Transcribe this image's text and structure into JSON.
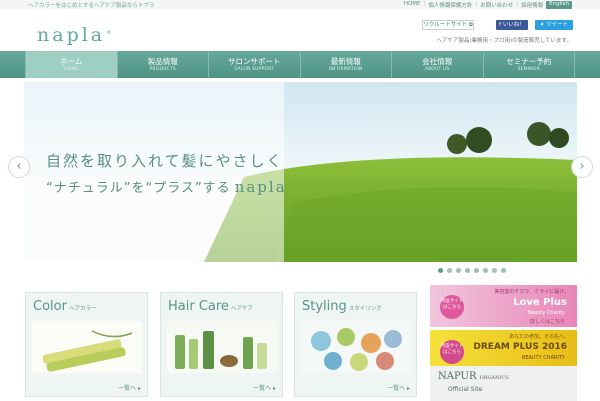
{
  "header": {
    "tagline": "ヘアカラーをはじめとするヘアケア製品ならナプラ",
    "top_links": [
      "HOME",
      "個人情報保護方針",
      "お問い合わせ",
      "採用情報"
    ],
    "english_label": "English",
    "logo": "napla",
    "logo_mark": "®",
    "recruit_label": "リクルートサイト",
    "facebook_label": "いいね！",
    "twitter_label": "ツイート",
    "subnote": "ヘアケア製品(業務用・プロ用)の製造販売しています。"
  },
  "nav": [
    {
      "jp": "ホーム",
      "en": "HOME",
      "active": true
    },
    {
      "jp": "製品情報",
      "en": "PRODUCTS",
      "active": false
    },
    {
      "jp": "サロンサポート",
      "en": "SALON SUPPORT",
      "active": false
    },
    {
      "jp": "最新情報",
      "en": "INFORMATION",
      "active": false
    },
    {
      "jp": "会社情報",
      "en": "ABOUT US",
      "active": false
    },
    {
      "jp": "セミナー予約",
      "en": "SEMINOR",
      "active": false
    }
  ],
  "hero": {
    "line1": "自然を取り入れて髪にやさしく",
    "line2": "“ナチュラル”を“プラス”する",
    "logo": "napla",
    "slide_count": 8,
    "active_slide": 0
  },
  "cards": [
    {
      "title": "Color",
      "subtitle": "ヘアカラー",
      "more": "一覧へ ▸"
    },
    {
      "title": "Hair Care",
      "subtitle": "ヘアケア",
      "more": "一覧へ ▸"
    },
    {
      "title": "Styling",
      "subtitle": "スタイリング",
      "more": "一覧へ ▸"
    }
  ],
  "banners": {
    "b1": {
      "head": "美容室のチカラ、ミライに届け。",
      "title": "Love Plus",
      "sub": "Beauty Charity",
      "badge": "特設サイトはこちら",
      "more": "詳しくはこちら"
    },
    "b2": {
      "head": "あなたの参加、その先へ。",
      "title": "DREAM PLUS 2016",
      "sub": "BEAUTY CHARITY",
      "badge": "特設サイトはこちら"
    },
    "b3": {
      "title": "NAPUR",
      "title_suffix": "ORGANICS",
      "sub": "Official Site"
    }
  },
  "colors": {
    "brand": "#5ea89c",
    "nav": "#5a9a8c"
  }
}
